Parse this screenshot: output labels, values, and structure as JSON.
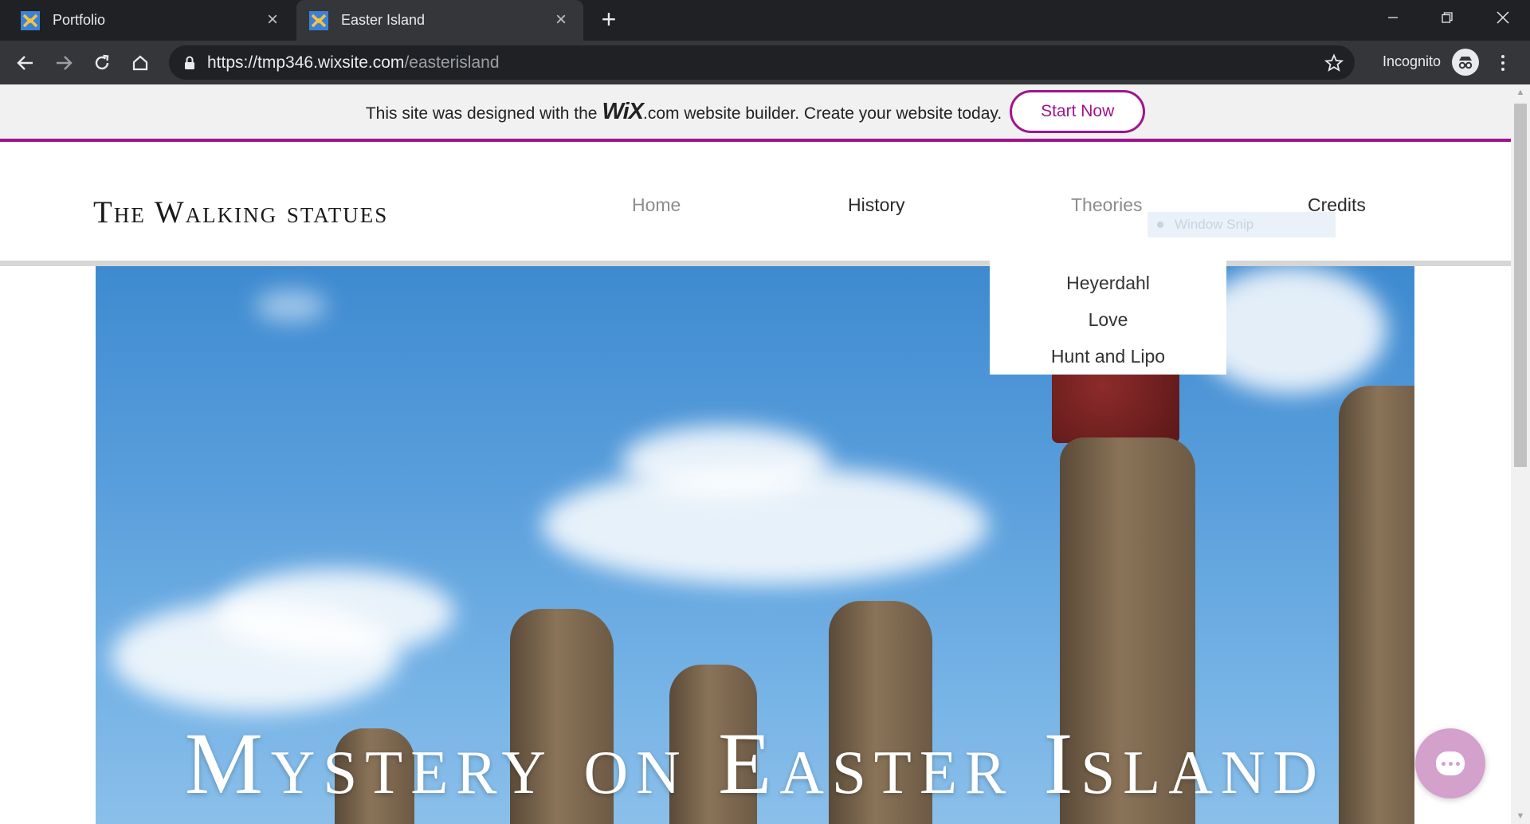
{
  "browser": {
    "tabs": [
      {
        "title": "Portfolio",
        "active": false
      },
      {
        "title": "Easter Island",
        "active": true
      }
    ],
    "url": {
      "host": "https://tmp346.wixsite.com",
      "path": "/easterisland"
    },
    "incognito_label": "Incognito",
    "icons": {
      "back": "back-arrow-icon",
      "forward": "forward-arrow-icon",
      "reload": "reload-icon",
      "home": "home-icon",
      "lock": "lock-icon",
      "star": "star-icon",
      "incognito": "incognito-icon"
    }
  },
  "wix_banner": {
    "prefix": "This site was designed with the",
    "logo": "WiX",
    "suffix": ".com website builder. Create your website today.",
    "cta": "Start Now",
    "accent": "#a0138e"
  },
  "site": {
    "logo": "The Walking statues",
    "nav": [
      {
        "label": "Home"
      },
      {
        "label": "History"
      },
      {
        "label": "Theories"
      },
      {
        "label": "Credits"
      }
    ],
    "theories_dropdown": [
      "Heyerdahl",
      "Love",
      "Hunt and Lipo"
    ],
    "hero_title": "Mystery on Easter Island"
  },
  "overlay": {
    "window_snip": "Window Snip"
  },
  "colors": {
    "chrome_dark": "#202124",
    "chrome_mid": "#35363a",
    "chat_button": "#d4a0cc"
  }
}
